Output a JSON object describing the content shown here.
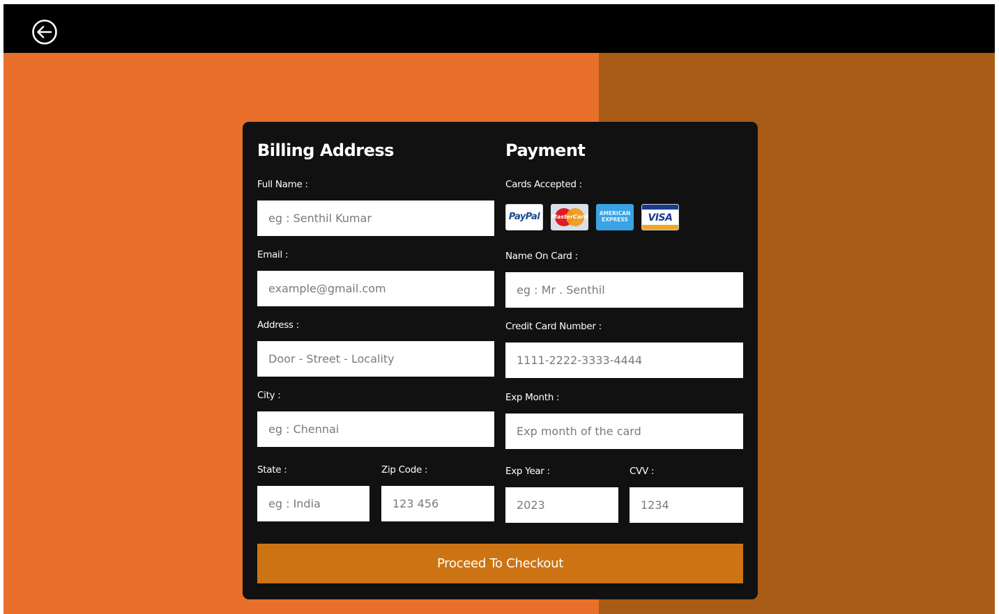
{
  "header": {
    "back_icon": "arrow-left-circle-icon"
  },
  "colors": {
    "accent": "#cc7414",
    "bg_left": "#e8702a",
    "bg_right": "#a85c16",
    "card_bg": "#111111",
    "topbar": "#000000"
  },
  "billing": {
    "title": "Billing Address",
    "full_name_label": "Full Name :",
    "full_name_placeholder": "eg : Senthil Kumar",
    "email_label": "Email :",
    "email_placeholder": "example@gmail.com",
    "address_label": "Address :",
    "address_placeholder": "Door - Street - Locality",
    "city_label": "City :",
    "city_placeholder": "eg : Chennai",
    "state_label": "State :",
    "state_placeholder": "eg : India",
    "zip_label": "Zip Code :",
    "zip_placeholder": "123 456"
  },
  "payment": {
    "title": "Payment",
    "cards_label": "Cards Accepted :",
    "cards": [
      {
        "name": "PayPal",
        "icon": "paypal-icon",
        "text": "PayPal"
      },
      {
        "name": "MasterCard",
        "icon": "mastercard-icon",
        "text": "MasterCard"
      },
      {
        "name": "American Express",
        "icon": "amex-icon",
        "text": "AMERICAN EXPRESS"
      },
      {
        "name": "Visa",
        "icon": "visa-icon",
        "text": "VISA"
      }
    ],
    "name_on_card_label": "Name On Card :",
    "name_on_card_placeholder": "eg : Mr . Senthil",
    "card_number_label": "Credit Card Number :",
    "card_number_placeholder": "1111-2222-3333-4444",
    "exp_month_label": "Exp Month :",
    "exp_month_placeholder": "Exp month of the card",
    "exp_year_label": "Exp Year :",
    "exp_year_placeholder": "2023",
    "cvv_label": "CVV :",
    "cvv_placeholder": "1234"
  },
  "checkout_label": "Proceed To Checkout"
}
